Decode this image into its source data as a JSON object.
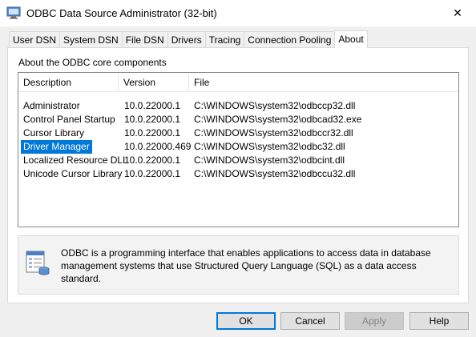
{
  "window": {
    "title": "ODBC Data Source Administrator (32-bit)",
    "close_glyph": "✕"
  },
  "tabs": [
    {
      "label": "User DSN",
      "active": false
    },
    {
      "label": "System DSN",
      "active": false
    },
    {
      "label": "File DSN",
      "active": false
    },
    {
      "label": "Drivers",
      "active": false
    },
    {
      "label": "Tracing",
      "active": false
    },
    {
      "label": "Connection Pooling",
      "active": false
    },
    {
      "label": "About",
      "active": true
    }
  ],
  "about": {
    "group_label": "About the ODBC core components",
    "columns": [
      "Description",
      "Version",
      "File"
    ],
    "rows": [
      {
        "description": "Administrator",
        "version": "10.0.22000.1",
        "file": "C:\\WINDOWS\\system32\\odbccp32.dll",
        "selected": false
      },
      {
        "description": "Control Panel Startup",
        "version": "10.0.22000.1",
        "file": "C:\\WINDOWS\\system32\\odbcad32.exe",
        "selected": false
      },
      {
        "description": "Cursor Library",
        "version": "10.0.22000.1",
        "file": "C:\\WINDOWS\\system32\\odbccr32.dll",
        "selected": false
      },
      {
        "description": "Driver Manager",
        "version": "10.0.22000.469",
        "file": "C:\\WINDOWS\\system32\\odbc32.dll",
        "selected": true
      },
      {
        "description": "Localized Resource DLL",
        "version": "10.0.22000.1",
        "file": "C:\\WINDOWS\\system32\\odbcint.dll",
        "selected": false
      },
      {
        "description": "Unicode Cursor Library",
        "version": "10.0.22000.1",
        "file": "C:\\WINDOWS\\system32\\odbccu32.dll",
        "selected": false
      }
    ],
    "info_text": "ODBC is a programming interface that enables applications to access data in database management systems that use Structured Query Language (SQL) as a data access standard.",
    "info_icon": "database-document-icon"
  },
  "buttons": {
    "ok": "OK",
    "cancel": "Cancel",
    "apply": "Apply",
    "help": "Help"
  },
  "colors": {
    "selection": "#0078d7",
    "default_button_border": "#0078d7"
  }
}
